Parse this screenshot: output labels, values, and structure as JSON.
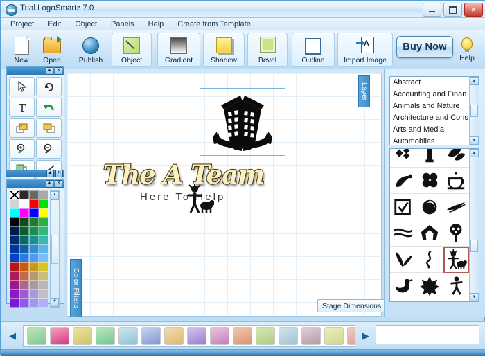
{
  "window": {
    "title": "Trial LogoSmartz 7.0",
    "app_icon": "logosmartz-icon",
    "controls": {
      "minimize": "minimize-button",
      "maximize": "maximize-button",
      "close": "✕"
    }
  },
  "menu": {
    "items": [
      {
        "label": "Project"
      },
      {
        "label": "Edit"
      },
      {
        "label": "Object"
      },
      {
        "label": "Panels"
      },
      {
        "label": "Help"
      },
      {
        "label": "Create from Template"
      }
    ]
  },
  "toolbar": {
    "buttons": [
      {
        "label": "New",
        "icon": "new-page-icon",
        "framed": false
      },
      {
        "label": "Open",
        "icon": "open-folder-icon",
        "framed": false
      },
      {
        "label": "Publish",
        "icon": "publish-globe-icon",
        "framed": false
      },
      {
        "label": "Object",
        "icon": "object-icon",
        "framed": true
      },
      {
        "label": "Gradient",
        "icon": "gradient-icon",
        "framed": true
      },
      {
        "label": "Shadow",
        "icon": "shadow-icon",
        "framed": true
      },
      {
        "label": "Bevel",
        "icon": "bevel-icon",
        "framed": true
      },
      {
        "label": "Outline",
        "icon": "outline-icon",
        "framed": true
      },
      {
        "label": "Import Image",
        "icon": "import-image-icon",
        "framed": true
      }
    ],
    "buy_now": "Buy Now",
    "help": "Help",
    "help_icon": "lightbulb-icon"
  },
  "tool_panel": {
    "tools": [
      {
        "name": "select-arrow-tool"
      },
      {
        "name": "redo-tool"
      },
      {
        "name": "text-tool"
      },
      {
        "name": "undo-tool"
      },
      {
        "name": "bring-forward-tool"
      },
      {
        "name": "send-backward-tool"
      },
      {
        "name": "zoom-in-tool"
      },
      {
        "name": "zoom-out-tool"
      },
      {
        "name": "duplicate-tool"
      },
      {
        "name": "line-tool"
      }
    ]
  },
  "color_panel": {
    "swatches": [
      "transparent",
      "#2b2b2b",
      "#696969",
      "#a9a9a9",
      "#d4d4d4",
      "#ffffff",
      "#ff0000",
      "#00e000",
      "#00ffff",
      "#ff00ff",
      "#0000ff",
      "#ffff00",
      "#000000",
      "#0b4b1e",
      "#1f7a32",
      "#2fae45",
      "#001a4d",
      "#0c5c2e",
      "#1c8c55",
      "#35b877",
      "#002b73",
      "#0a6b63",
      "#1a9090",
      "#3cb6b0",
      "#00379b",
      "#1060a8",
      "#2f8fd0",
      "#5ab4ea",
      "#0043c4",
      "#2a7be0",
      "#4f9bf0",
      "#79bdf8",
      "#b01a1a",
      "#c85a12",
      "#c79a16",
      "#d8c41e",
      "#b01a5a",
      "#c06a4a",
      "#b89a6a",
      "#c8c07a",
      "#9a1a8a",
      "#a86a8a",
      "#a89aa0",
      "#b8b8b8",
      "#8a1ac4",
      "#9a5ad0",
      "#a89ad8",
      "#c0c0c8",
      "#7a1ad8",
      "#8a5ae8",
      "#9a9af0",
      "#b0b0f8"
    ],
    "scroll_up": "▲",
    "scroll_down": "▼"
  },
  "canvas": {
    "layer_tab": "Layer",
    "color_filters_tab": "Color Filters",
    "stage_dimensions": "Stage Dimensions",
    "logo": {
      "graphic": "twin-towers-building-icon",
      "title": "The A Team",
      "tagline": "Here To Help",
      "overlay_graphic": "person-with-animal-icon"
    }
  },
  "right_panel": {
    "categories": [
      "Abstract",
      "Accounting and Finan",
      "Animals and Nature",
      "Architecture and Cons",
      "Arts and Media",
      "Automobiles"
    ],
    "selected_category": "Abstract",
    "clipart": [
      {
        "name": "diamond-cluster-icon",
        "selected": false
      },
      {
        "name": "tower-icon",
        "selected": false
      },
      {
        "name": "leaves-pair-icon",
        "selected": false
      },
      {
        "name": "chili-pepper-icon",
        "selected": false
      },
      {
        "name": "clover-icon",
        "selected": false
      },
      {
        "name": "coffee-cup-icon",
        "selected": false
      },
      {
        "name": "checkbox-check-icon",
        "selected": false
      },
      {
        "name": "spiral-swirl-icon",
        "selected": false
      },
      {
        "name": "wheat-sprig-icon",
        "selected": false
      },
      {
        "name": "wavy-lines-icon",
        "selected": false
      },
      {
        "name": "arch-arrow-icon",
        "selected": false
      },
      {
        "name": "golf-tee-face-icon",
        "selected": false
      },
      {
        "name": "leaf-branch-icon",
        "selected": false
      },
      {
        "name": "squiggle-icon",
        "selected": false
      },
      {
        "name": "person-with-animal-icon",
        "selected": true
      },
      {
        "name": "peacock-icon",
        "selected": false
      },
      {
        "name": "snowflake-star-icon",
        "selected": false
      },
      {
        "name": "walking-person-icon",
        "selected": false
      }
    ],
    "scroll_up": "▲",
    "scroll_down": "▼"
  },
  "bottom_bar": {
    "prev_arrow": "◀",
    "next_arrow": "▶",
    "gradients": [
      "linear-gradient(160deg,#bfe4b8,#7fc98f)",
      "linear-gradient(160deg,#f0a7c0,#d8357f)",
      "linear-gradient(160deg,#ece4a8,#cfc45f)",
      "linear-gradient(160deg,#bfe7c0,#6fc98d)",
      "linear-gradient(160deg,#cfe6ee,#8cc2d8)",
      "linear-gradient(160deg,#c7d4ee,#7f96d4)",
      "linear-gradient(160deg,#f0dcb4,#e2b86a)",
      "linear-gradient(160deg,#d4c4ea,#9a7fcf)",
      "linear-gradient(160deg,#e8c4e2,#c77fb8)",
      "linear-gradient(160deg,#f0c8b0,#dd9470)",
      "linear-gradient(160deg,#d8e8b8,#a8cf7f)",
      "linear-gradient(160deg,#cfe4ea,#9ec6d4)",
      "linear-gradient(160deg,#e0cfd8,#b49aa8)",
      "linear-gradient(160deg,#eaf0c0,#cdd888)",
      "linear-gradient(160deg,#f0ccc4,#dd9a8f)",
      "linear-gradient(160deg,#cfe6ee,#9ec8da)",
      "linear-gradient(160deg,#d8cfe8,#a894cf)",
      "linear-gradient(160deg,#f2c4cf,#e0849a)"
    ],
    "input_value": ""
  }
}
